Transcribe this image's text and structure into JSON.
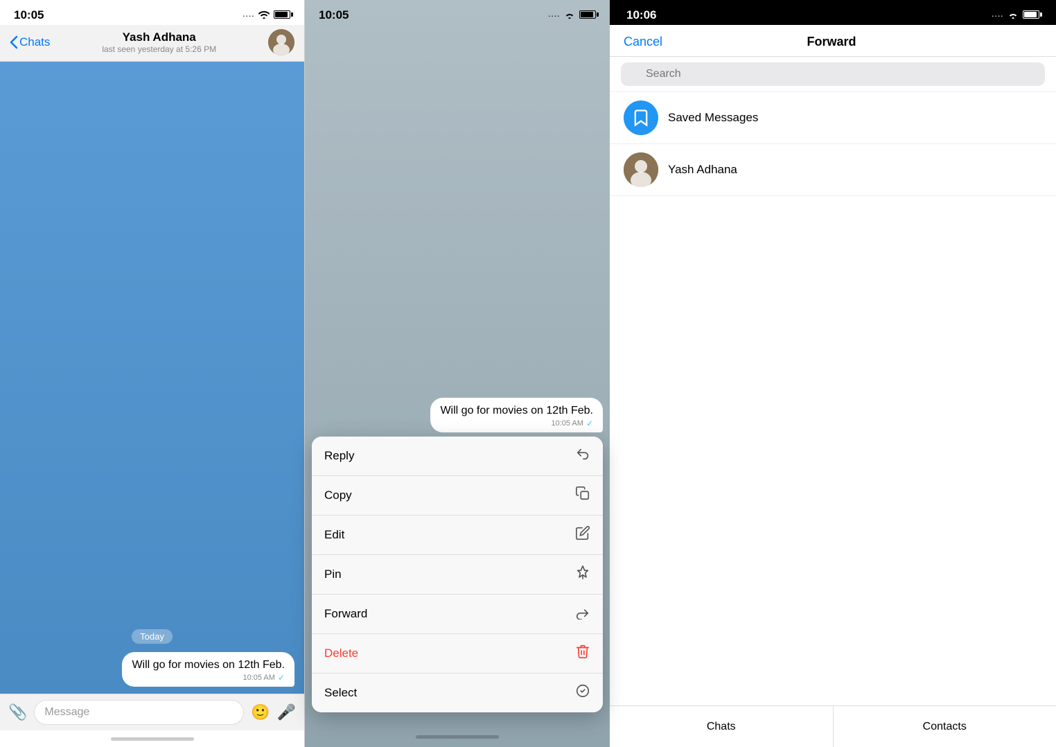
{
  "panel1": {
    "status": {
      "time": "10:05",
      "signal": "····",
      "wifi": "WiFi",
      "battery": "Battery"
    },
    "nav": {
      "back_label": "Chats",
      "contact_name": "Yash Adhana",
      "last_seen": "last seen yesterday at 5:26 PM"
    },
    "chat": {
      "today_label": "Today",
      "message_text": "Will go for movies on 12th Feb.",
      "message_time": "10:05 AM",
      "check_mark": "✓"
    },
    "input": {
      "placeholder": "Message",
      "attach_icon": "📎",
      "sticker_icon": "🙂",
      "mic_icon": "🎤"
    },
    "home_indicator": "—"
  },
  "panel2": {
    "status": {
      "time": "10:05",
      "signal": "····",
      "wifi": "WiFi",
      "battery": "Battery"
    },
    "message": {
      "text": "Will go for movies on 12th Feb.",
      "time": "10:05 AM",
      "check_mark": "✓"
    },
    "context_menu": {
      "items": [
        {
          "label": "Reply",
          "icon": "↩",
          "is_delete": false
        },
        {
          "label": "Copy",
          "icon": "⧉",
          "is_delete": false
        },
        {
          "label": "Edit",
          "icon": "✎",
          "is_delete": false
        },
        {
          "label": "Pin",
          "icon": "📌",
          "is_delete": false
        },
        {
          "label": "Forward",
          "icon": "↪",
          "is_delete": false
        },
        {
          "label": "Delete",
          "icon": "🗑",
          "is_delete": true
        },
        {
          "label": "Select",
          "icon": "✓",
          "is_delete": false
        }
      ]
    }
  },
  "panel3": {
    "status": {
      "time": "10:06",
      "signal": "····",
      "wifi": "WiFi",
      "battery": "Battery"
    },
    "nav": {
      "cancel_label": "Cancel",
      "title": "Forward"
    },
    "search": {
      "placeholder": "Search"
    },
    "list": [
      {
        "name": "Saved Messages",
        "avatar_type": "saved",
        "icon": "▶"
      },
      {
        "name": "Yash Adhana",
        "avatar_type": "user",
        "icon": "Y"
      }
    ],
    "tabs": [
      {
        "label": "Chats"
      },
      {
        "label": "Contacts"
      }
    ]
  }
}
